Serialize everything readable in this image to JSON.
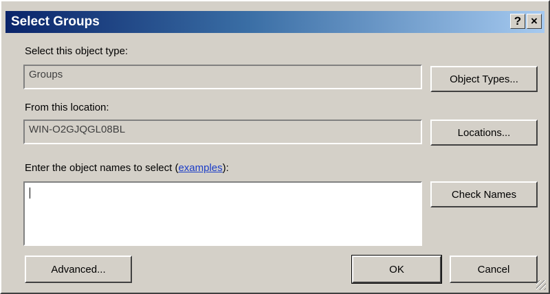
{
  "window": {
    "title": "Select Groups",
    "help_label": "?",
    "close_label": "×"
  },
  "object_type": {
    "label": "Select this object type:",
    "value": "Groups",
    "button": "Object Types..."
  },
  "location": {
    "label": "From this location:",
    "value": "WIN-O2GJQGL08BL",
    "button": "Locations..."
  },
  "names": {
    "label_prefix": "Enter the object names to select (",
    "link": "examples",
    "label_suffix": "):",
    "value": "",
    "check_button": "Check Names"
  },
  "footer": {
    "advanced": "Advanced...",
    "ok": "OK",
    "cancel": "Cancel"
  }
}
